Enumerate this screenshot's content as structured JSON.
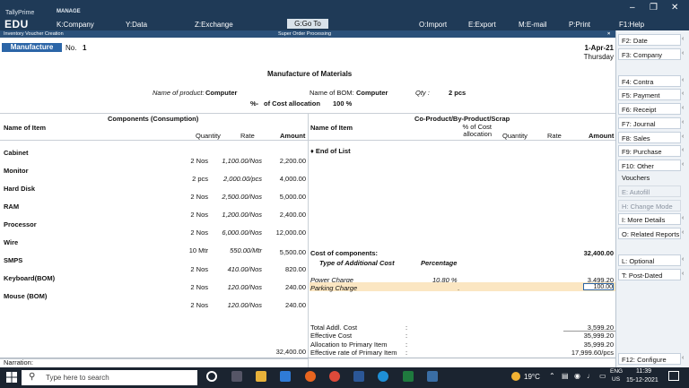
{
  "app": {
    "brand_top": "TallyPrime",
    "brand": "EDU",
    "manage": "MANAGE"
  },
  "menu": {
    "company": "K:Company",
    "data": "Y:Data",
    "exchange": "Z:Exchange",
    "goto": "G:Go To",
    "import": "O:Import",
    "export": "E:Export",
    "email": "M:E-mail",
    "print": "P:Print",
    "help": "F1:Help"
  },
  "subbar": {
    "left": "Inventory Voucher Creation",
    "center": "Super Order Processing",
    "close": "×"
  },
  "voucher": {
    "type": "Manufacture",
    "no_label": "No.",
    "no": "1",
    "date": "1-Apr-21",
    "day": "Thursday",
    "title": "Manufacture of Materials"
  },
  "product": {
    "name_label": "Name of product:",
    "name": "Computer",
    "bom_label": "Name of BOM:",
    "bom": "Computer",
    "qty_label": "Qty :",
    "qty": "2 pcs",
    "pct": "%-",
    "alloc_label": "of Cost allocation",
    "alloc": "100 %"
  },
  "components": {
    "header": "Components (Consumption)",
    "col_name": "Name of Item",
    "col_qty": "Quantity",
    "col_rate": "Rate",
    "col_amount": "Amount",
    "items": [
      {
        "name": "Cabinet",
        "qty": "2 Nos",
        "rate": "1,100.00/Nos",
        "amount": "2,200.00"
      },
      {
        "name": "Monitor",
        "qty": "2 pcs",
        "rate": "2,000.00/pcs",
        "amount": "4,000.00"
      },
      {
        "name": "Hard Disk",
        "qty": "2 Nos",
        "rate": "2,500.00/Nos",
        "amount": "5,000.00"
      },
      {
        "name": "RAM",
        "qty": "2 Nos",
        "rate": "1,200.00/Nos",
        "amount": "2,400.00"
      },
      {
        "name": "Processor",
        "qty": "2 Nos",
        "rate": "6,000.00/Nos",
        "amount": "12,000.00"
      },
      {
        "name": "Wire",
        "qty": "10 Mtr",
        "rate": "550.00/Mtr",
        "amount": "5,500.00"
      },
      {
        "name": "SMPS",
        "qty": "2 Nos",
        "rate": "410.00/Nos",
        "amount": "820.00"
      },
      {
        "name": "Keyboard(BOM)",
        "qty": "2 Nos",
        "rate": "120.00/Nos",
        "amount": "240.00"
      },
      {
        "name": "Mouse (BOM)",
        "qty": "2 Nos",
        "rate": "120.00/Nos",
        "amount": "240.00"
      }
    ],
    "total": "32,400.00"
  },
  "coproduct": {
    "header": "Co-Product/By-Product/Scrap",
    "col_name": "Name of Item",
    "col_pct": "% of Cost allocation",
    "col_qty": "Quantity",
    "col_rate": "Rate",
    "col_amount": "Amount",
    "end": "♦ End of List"
  },
  "costs": {
    "cost_label": "Cost of components:",
    "cost_value": "32,400.00",
    "type_label": "Type of Additional Cost",
    "pct_label": "Percentage",
    "rows": [
      {
        "name": "Power Charge",
        "pct": "10.80 %",
        "amount": "3,499.20"
      },
      {
        "name": "Parking Charge",
        "pct": ".",
        "amount": "100.00"
      }
    ]
  },
  "summary": [
    {
      "label": "Total Addl. Cost",
      "value": "3,599.20"
    },
    {
      "label": "Effective Cost",
      "value": "35,999.20"
    },
    {
      "label": "Allocation to Primary Item",
      "value": "35,999.20"
    },
    {
      "label": "Effective rate of Primary Item",
      "value": "17,999.60/pcs"
    }
  ],
  "narration": "Narration:",
  "rpanel": [
    {
      "label": "F2: Date",
      "disabled": false
    },
    {
      "label": "F3: Company",
      "disabled": false
    },
    {
      "label": "F4: Contra",
      "disabled": false
    },
    {
      "label": "F5: Payment",
      "disabled": false
    },
    {
      "label": "F6: Receipt",
      "disabled": false
    },
    {
      "label": "F7: Journal",
      "disabled": false
    },
    {
      "label": "F8: Sales",
      "disabled": false
    },
    {
      "label": "F9: Purchase",
      "disabled": false
    },
    {
      "label": "F10: Other Vouchers",
      "disabled": false
    },
    {
      "label": "E: Autofill",
      "disabled": true
    },
    {
      "label": "H: Change Mode",
      "disabled": true
    },
    {
      "label": "I: More Details",
      "disabled": false
    },
    {
      "label": "O: Related Reports",
      "disabled": false
    },
    {
      "label": "L: Optional",
      "disabled": false
    },
    {
      "label": "T: Post-Dated",
      "disabled": false
    },
    {
      "label": "F12: Configure",
      "disabled": false
    }
  ],
  "taskbar": {
    "search": "Type here to search",
    "weather": "19°C",
    "lang1": "ENG",
    "lang2": "US",
    "time": "11:39",
    "date": "15-12-2021"
  }
}
